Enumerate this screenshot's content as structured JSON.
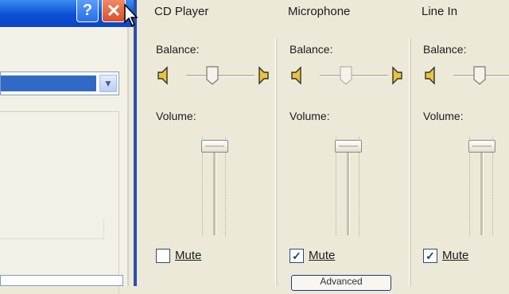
{
  "dialog": {
    "help_button": "?",
    "close_button": "✕",
    "dropdown_arrow": "▼"
  },
  "channels": [
    {
      "title": "CD Player",
      "balance_label": "Balance:",
      "volume_label": "Volume:",
      "mute_label": "Mute",
      "muted": false,
      "balance_level": 0.5,
      "volume_level": 0.95
    },
    {
      "title": "Microphone",
      "balance_label": "Balance:",
      "volume_label": "Volume:",
      "mute_label": "Mute",
      "muted": true,
      "balance_level": 0.5,
      "volume_level": 0.95
    },
    {
      "title": "Line In",
      "balance_label": "Balance:",
      "volume_label": "Volume:",
      "mute_label": "Mute",
      "muted": true,
      "balance_level": 0.5,
      "volume_level": 0.95
    }
  ],
  "advanced_button_label": "Advanced",
  "colors": {
    "titlebar": "#0a4fd4",
    "face": "#ece9d8",
    "close": "#d8502c"
  }
}
